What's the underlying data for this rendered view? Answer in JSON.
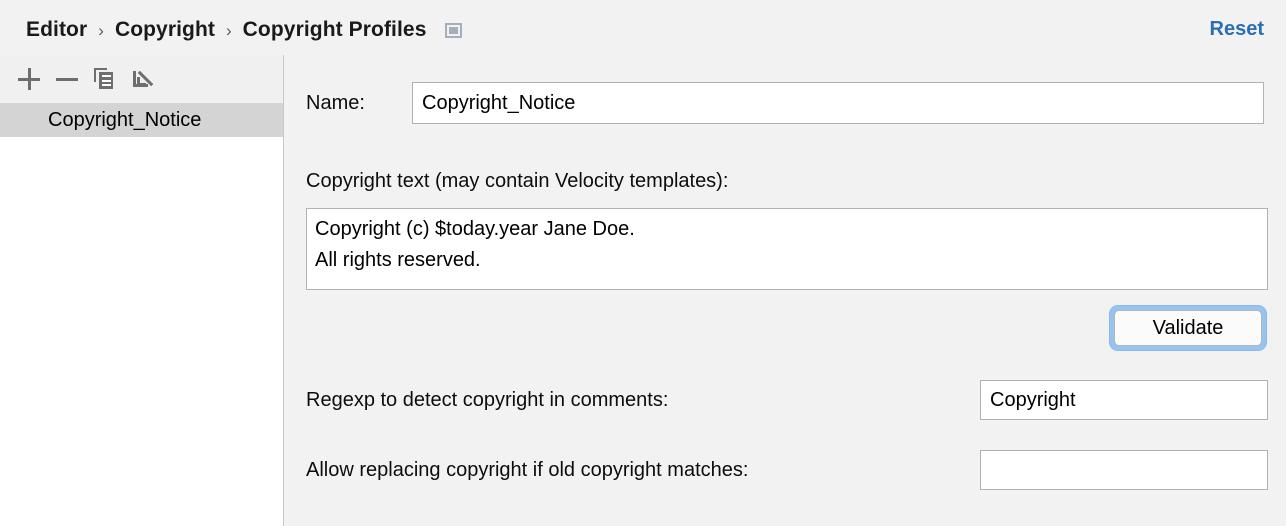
{
  "header": {
    "breadcrumb": [
      "Editor",
      "Copyright",
      "Copyright Profiles"
    ],
    "separator": "›",
    "panel_icon": "panel-window-icon",
    "reset_label": "Reset",
    "link_color": "#2a6fb5"
  },
  "sidebar": {
    "toolbar": [
      {
        "name": "add-profile-button",
        "icon": "plus-icon",
        "tooltip": "Add"
      },
      {
        "name": "remove-profile-button",
        "icon": "minus-icon",
        "tooltip": "Remove"
      },
      {
        "name": "copy-profile-button",
        "icon": "copy-icon",
        "tooltip": "Copy"
      },
      {
        "name": "import-profile-button",
        "icon": "import-icon",
        "tooltip": "Import"
      }
    ],
    "profiles": [
      {
        "label": "Copyright_Notice",
        "selected": true
      }
    ],
    "selection_color": "#d4d4d4"
  },
  "form": {
    "name_label": "Name:",
    "name_value": "Copyright_Notice",
    "name_placeholder": "",
    "copyright_text_label": "Copyright text (may contain Velocity templates):",
    "copyright_text_value": "Copyright (c) $today.year Jane Doe.\nAll rights reserved.",
    "copyright_text_placeholder": "",
    "validate_label": "Validate",
    "validate_focused": true,
    "focus_ring_color": "#97c3f0",
    "regexp_label": "Regexp to detect copyright in comments:",
    "regexp_value": "Copyright",
    "regexp_placeholder": "",
    "allow_replace_label": "Allow replacing copyright if old copyright matches:",
    "allow_replace_value": "",
    "allow_replace_placeholder": ""
  }
}
